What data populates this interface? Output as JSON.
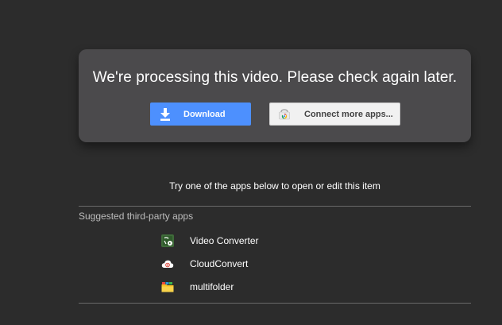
{
  "processing": {
    "message": "We're processing this video. Please check again later."
  },
  "actions": {
    "download_label": "Download",
    "download_icon": "download-icon",
    "connect_label": "Connect more apps...",
    "connect_icon": "chrome-web-store-icon"
  },
  "hint": "Try one of the apps below to open or edit this item",
  "suggested": {
    "label": "Suggested third-party apps",
    "apps": [
      {
        "name": "Video Converter",
        "icon": "video-converter-icon"
      },
      {
        "name": "CloudConvert",
        "icon": "cloudconvert-icon"
      },
      {
        "name": "multifolder",
        "icon": "multifolder-icon"
      }
    ]
  },
  "colors": {
    "background": "#2c2c2c",
    "card": "#4b4a4c",
    "download_button": "#4d90fe",
    "connect_button": "#f1f1f1"
  }
}
